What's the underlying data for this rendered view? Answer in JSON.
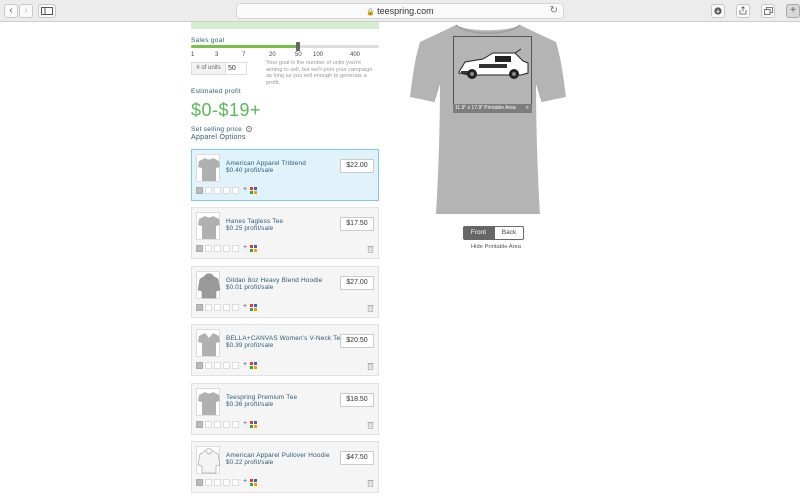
{
  "browser": {
    "url": "teespring.com",
    "back_icon": "chevron-left-icon",
    "forward_icon": "chevron-right-icon"
  },
  "sales_goal": {
    "label": "Sales goal",
    "ticks": [
      "1",
      "3",
      "7",
      "20",
      "50",
      "100",
      "400"
    ],
    "selected_fraction": 0.57,
    "units_label": "# of units",
    "units_value": "50",
    "help": "Your goal is the number of units you're aiming to sell, but we'll print your campaign as long as you sell enough to generate a profit."
  },
  "estimate": {
    "label": "Estimated profit",
    "value": "$0-$19+"
  },
  "selling_price": {
    "label": "Set selling price",
    "help_icon": "question-circle-icon"
  },
  "apparel": {
    "title": "Apparel Options",
    "items": [
      {
        "name": "American Apparel Triblend",
        "profit": "$0.40 profit/sale",
        "price": "$22.00",
        "selected": true
      },
      {
        "name": "Hanes Tagless Tee",
        "profit": "$0.25 profit/sale",
        "price": "$17.50",
        "selected": false
      },
      {
        "name": "Gildan 8oz Heavy Blend Hoodie",
        "profit": "$0.01 profit/sale",
        "price": "$27.00",
        "selected": false
      },
      {
        "name": "BELLA+CANVAS Women's V-Neck Tee",
        "profit": "$0.39 profit/sale",
        "price": "$20.50",
        "selected": false
      },
      {
        "name": "Teespring Premium Tee",
        "profit": "$0.36 profit/sale",
        "price": "$18.50",
        "selected": false
      },
      {
        "name": "American Apparel Pullover Hoodie",
        "profit": "$0.22 profit/sale",
        "price": "$47.50",
        "selected": false
      }
    ]
  },
  "preview": {
    "printable_label": "11.9\" x 17.9\" Printable Area",
    "front_label": "Front",
    "back_label": "Back",
    "hide_label": "Hide Printable Area"
  },
  "colors": {
    "accent_green": "#5cb85c",
    "slider_green": "#7bbf4a",
    "selected_bg": "#e0f3fb",
    "label_blue": "#2b5b7a"
  }
}
